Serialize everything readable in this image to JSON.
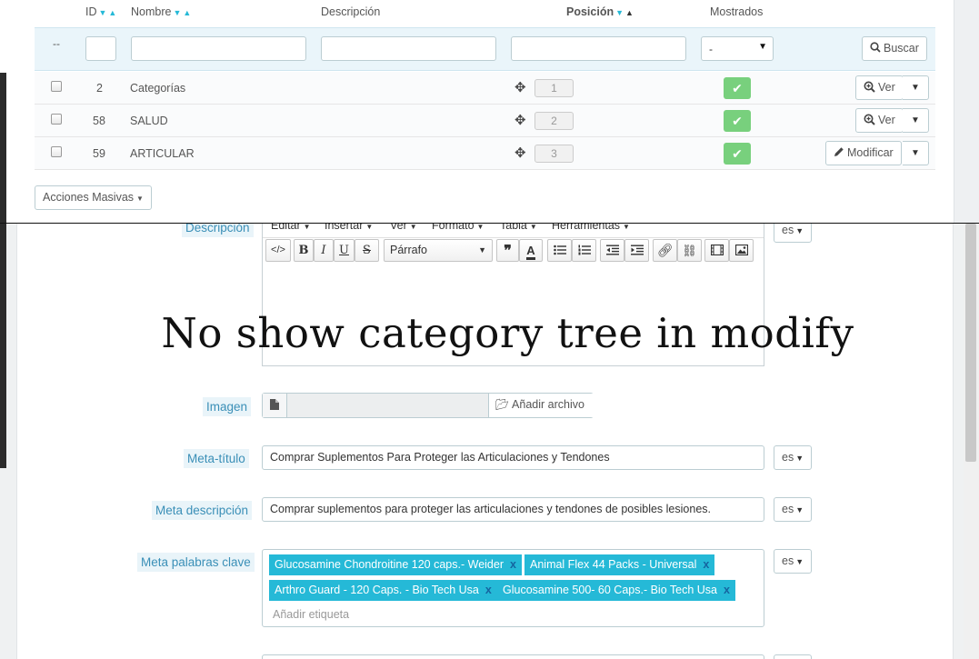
{
  "list": {
    "headers": {
      "id": "ID",
      "nombre": "Nombre",
      "descripcion": "Descripción",
      "posicion": "Posición",
      "mostrados": "Mostrados"
    },
    "filter": {
      "dash": "--",
      "select_value": "-",
      "search_button": "Buscar"
    },
    "rows": [
      {
        "id": "2",
        "name": "Categorías",
        "position": "1",
        "action": "Ver"
      },
      {
        "id": "58",
        "name": "SALUD",
        "position": "2",
        "action": "Ver"
      },
      {
        "id": "59",
        "name": "ARTICULAR",
        "position": "3",
        "action": "Modificar"
      }
    ],
    "bulk_actions": "Acciones Masivas"
  },
  "form": {
    "description_label": "Descripción",
    "editor": {
      "menu": [
        "Editar",
        "Insertar",
        "Ver",
        "Formato",
        "Tabla",
        "Herramientas"
      ],
      "format_select": "Párrafo"
    },
    "overlay_title": "No show category tree in modify",
    "image_label": "Imagen",
    "add_file_button": "Añadir archivo",
    "meta_title_label": "Meta-título",
    "meta_title_value": "Comprar Suplementos Para Proteger las Articulaciones y Tendones",
    "meta_desc_label": "Meta descripción",
    "meta_desc_value": "Comprar suplementos para proteger las articulaciones y tendones de posibles lesiones.",
    "meta_keywords_label": "Meta palabras clave",
    "tags": [
      "Glucosamine Chondroitine 120 caps.- Weider",
      "Animal Flex 44 Packs - Universal",
      "Arthro Guard - 120 Caps. - Bio Tech Usa",
      "Glucosamine 500- 60 Caps.- Bio Tech Usa"
    ],
    "tag_placeholder": "Añadir etiqueta",
    "lang_code": "es"
  },
  "colors": {
    "accent": "#25b9d7",
    "label_text": "#3a8fb7",
    "check_green": "#78d07d"
  }
}
